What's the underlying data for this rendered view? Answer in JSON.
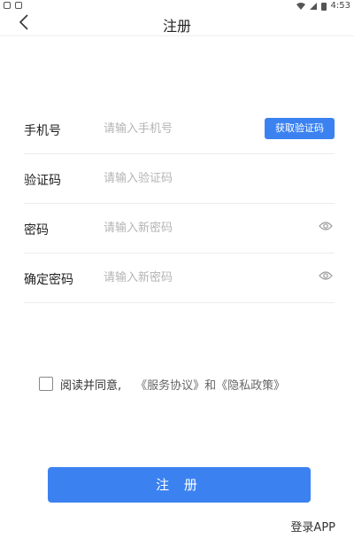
{
  "status_bar": {
    "time": "4:53"
  },
  "header": {
    "title": "注册"
  },
  "form": {
    "phone": {
      "label": "手机号",
      "placeholder": "请输入手机号",
      "code_button": "获取验证码"
    },
    "code": {
      "label": "验证码",
      "placeholder": "请输入验证码"
    },
    "password": {
      "label": "密码",
      "placeholder": "请输入新密码"
    },
    "confirm": {
      "label": "确定密码",
      "placeholder": "请输入新密码"
    }
  },
  "agreement": {
    "text": "阅读并同意,",
    "service": "《服务协议》",
    "and": "和",
    "privacy": "《隐私政策》"
  },
  "register_button": "注 册",
  "login_link": "登录APP",
  "colors": {
    "accent": "#3b82f0"
  },
  "icons": [
    "back-arrow-icon",
    "eye-icon",
    "wifi-icon",
    "signal-icon",
    "battery-icon"
  ]
}
